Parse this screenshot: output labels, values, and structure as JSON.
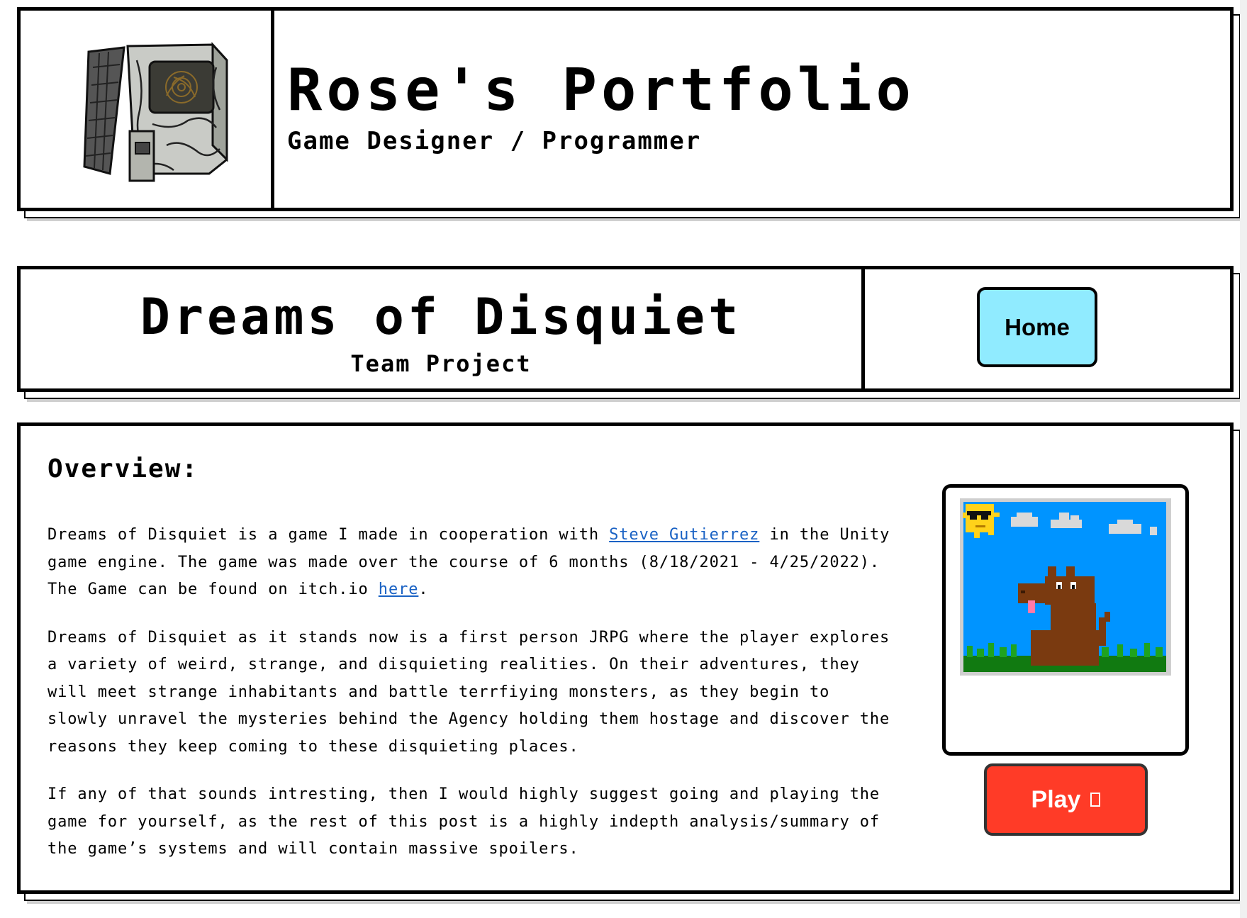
{
  "site": {
    "title": "Rose's Portfolio",
    "subtitle": "Game Designer / Programmer",
    "logo_icon": "retro-computer-rose-icon"
  },
  "project": {
    "title": "Dreams of Disquiet",
    "subtitle": "Team Project",
    "home_label": "Home"
  },
  "overview": {
    "heading": "Overview:",
    "p1_before_link": "Dreams of Disquiet is a game I made in cooperation with ",
    "p1_link": "Steve Gutierrez",
    "p1_middle": " in the Unity game engine. The game was made over the course of 6 months (8/18/2021 - 4/25/2022). The Game can be found on itch.io ",
    "p1_link2": "here",
    "p1_end": ".",
    "p2": "Dreams of Disquiet as it stands now is a first person JRPG where the player explores a variety of weird, strange, and disquieting realities. On their adventures, they will meet strange inhabitants and battle terrfiying monsters, as they begin to slowly unravel the mysteries behind the Agency holding them hostage and discover the reasons they keep coming to these disquieting places.",
    "p3": "If any of that sounds intresting, then I would highly suggest going and playing the game for yourself, as the rest of this post is a highly indepth analysis/summary of the game’s systems and will contain massive spoilers.",
    "play_label": "Play",
    "play_icon": "external-link-icon",
    "screenshot_icon": "pixel-art-horse-icon"
  },
  "colors": {
    "home_button": "#90ebff",
    "play_button": "#ff3b27",
    "link": "#1a62c4"
  }
}
